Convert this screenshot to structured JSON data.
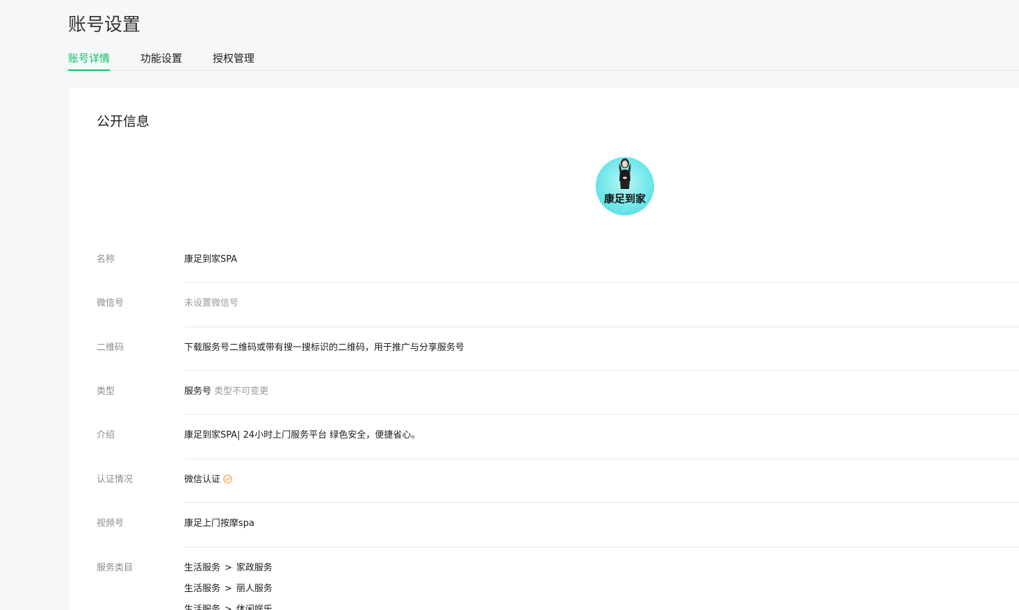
{
  "header": {
    "title": "账号设置"
  },
  "tabs": [
    {
      "label": "账号详情",
      "active": true
    },
    {
      "label": "功能设置",
      "active": false
    },
    {
      "label": "授权管理",
      "active": false
    }
  ],
  "section": {
    "title": "公开信息"
  },
  "avatar": {
    "text": "康足到家",
    "icon": "avatar-person-icon"
  },
  "rows": {
    "name": {
      "label": "名称",
      "value": "康足到家SPA"
    },
    "wechat_id": {
      "label": "微信号",
      "value": "未设置微信号"
    },
    "qrcode": {
      "label": "二维码",
      "value": "下载服务号二维码或带有搜一搜标识的二维码，用于推广与分享服务号"
    },
    "type": {
      "label": "类型",
      "value": "服务号",
      "note": "类型不可变更"
    },
    "intro": {
      "label": "介绍",
      "value": "康足到家SPA| 24小时上门服务平台 绿色安全，便捷省心。"
    },
    "verification": {
      "label": "认证情况",
      "value": "微信认证",
      "icon": "verified-check-icon"
    },
    "channels": {
      "label": "视频号",
      "value": "康足上门按摩spa"
    },
    "categories": {
      "label": "服务类目",
      "items": [
        {
          "main": "生活服务",
          "sep": ">",
          "sub": "家政服务"
        },
        {
          "main": "生活服务",
          "sep": ">",
          "sub": "丽人服务"
        },
        {
          "main": "生活服务",
          "sep": ">",
          "sub": "休闲娱乐"
        }
      ]
    }
  },
  "colors": {
    "accent": "#07c160",
    "verified": "#fa9d3b",
    "background": "#f6f7f9",
    "card": "#ffffff"
  }
}
